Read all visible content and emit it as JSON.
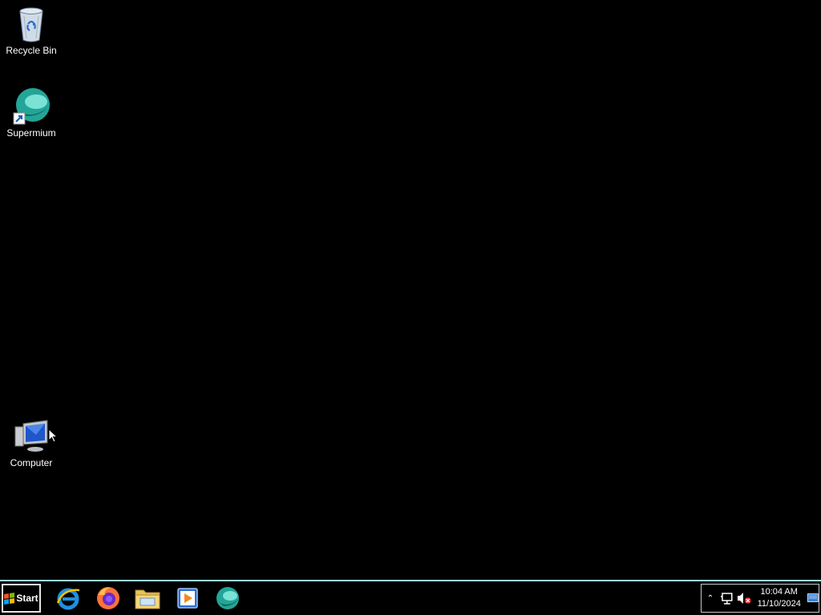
{
  "desktop": {
    "icons": [
      {
        "label": "Recycle Bin",
        "icon": "recycle-bin-icon"
      },
      {
        "label": "Supermium",
        "icon": "supermium-icon"
      },
      {
        "label": "Computer",
        "icon": "computer-icon"
      }
    ]
  },
  "taskbar": {
    "start_label": "Start",
    "pinned": [
      {
        "name": "Internet Explorer",
        "icon": "internet-explorer-icon"
      },
      {
        "name": "Firefox",
        "icon": "firefox-icon"
      },
      {
        "name": "File Explorer",
        "icon": "file-explorer-icon"
      },
      {
        "name": "Media Player",
        "icon": "media-player-icon"
      },
      {
        "name": "Supermium",
        "icon": "supermium-icon"
      }
    ],
    "tray": {
      "overflow_glyph": "⌃",
      "time": "10:04 AM",
      "date": "11/10/2024"
    }
  },
  "colors": {
    "desktop_bg": "#000000",
    "taskbar_border": "#9fe0e6",
    "supermium_teal": "#1fa89a"
  }
}
